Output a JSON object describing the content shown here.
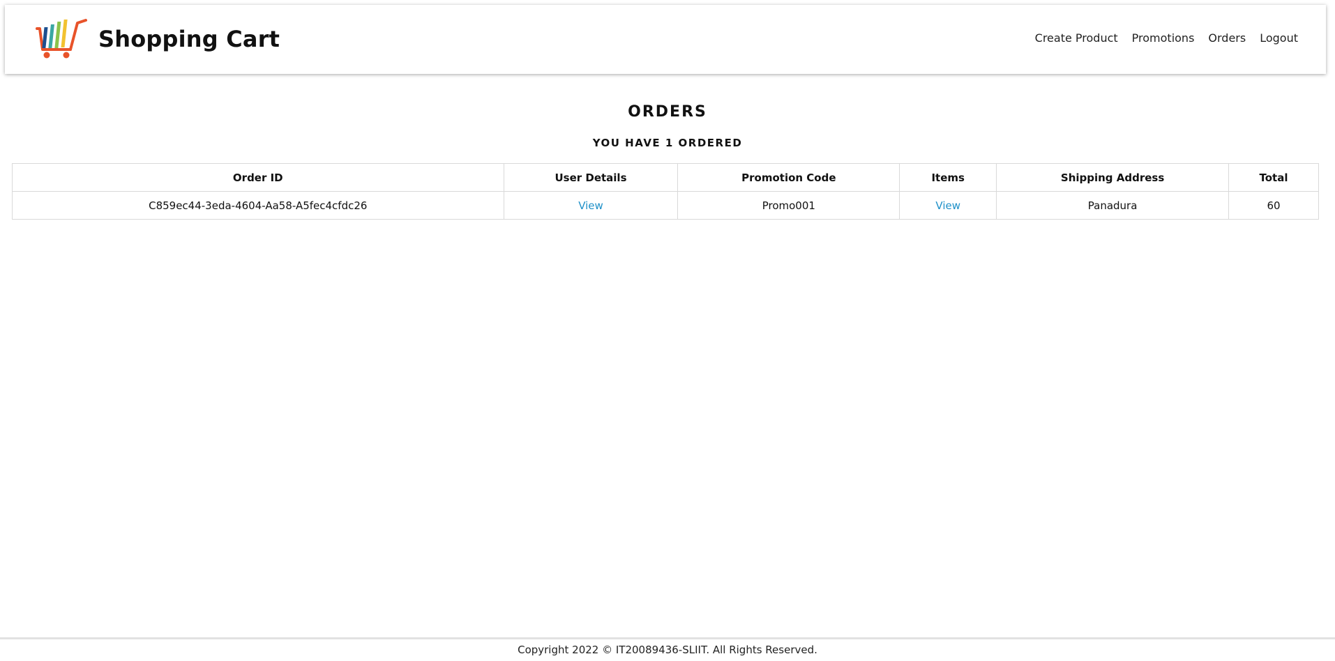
{
  "header": {
    "brand_title": "Shopping Cart",
    "logo_icon": "shopping-cart-logo-icon",
    "nav": {
      "create_product": "Create Product",
      "promotions": "Promotions",
      "orders": "Orders",
      "logout": "Logout"
    }
  },
  "main": {
    "title": "ORDERS",
    "subtitle": "YOU HAVE 1 ORDERED",
    "table": {
      "headers": [
        "Order ID",
        "User Details",
        "Promotion Code",
        "Items",
        "Shipping Address",
        "Total"
      ],
      "rows": [
        {
          "order_id": "C859ec44-3eda-4604-Aa58-A5fec4cfdc26",
          "user_details": "View",
          "promotion_code": "Promo001",
          "items": "View",
          "shipping_address": "Panadura",
          "total": "60"
        }
      ]
    }
  },
  "footer": {
    "copyright": "Copyright 2022 © IT20089436-SLIIT. All Rights Reserved."
  },
  "colors": {
    "link": "#1e90c8",
    "cart_orange": "#e8532a",
    "bar_blue": "#1c4f8f",
    "bar_teal": "#3aa7a3",
    "bar_green": "#8bc34a",
    "bar_yellow": "#f2c230"
  }
}
